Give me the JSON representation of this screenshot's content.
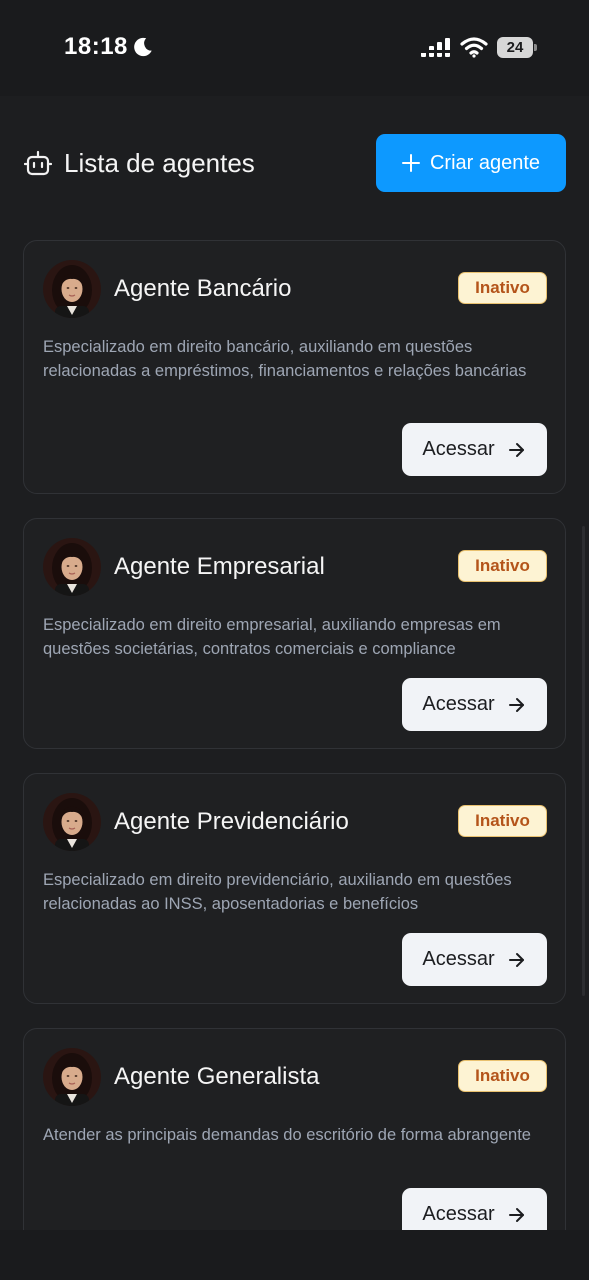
{
  "status_bar": {
    "time": "18:18",
    "battery": "24"
  },
  "header": {
    "title": "Lista de agentes",
    "create_label": "Criar agente"
  },
  "agents": [
    {
      "name": "Agente Bancário",
      "status": "Inativo",
      "description": "Especializado em direito bancário, auxiliando em questões relacionadas a empréstimos, financiamentos e relações bancárias",
      "action_label": "Acessar"
    },
    {
      "name": "Agente Empresarial",
      "status": "Inativo",
      "description": "Especializado em direito empresarial, auxiliando empresas em questões societárias, contratos comerciais e compliance",
      "action_label": "Acessar"
    },
    {
      "name": "Agente Previdenciário",
      "status": "Inativo",
      "description": "Especializado em direito previdenciário, auxiliando em questões relacionadas ao INSS, aposentadorias e benefícios",
      "action_label": "Acessar"
    },
    {
      "name": "Agente Generalista",
      "status": "Inativo",
      "description": "Atender as principais demandas do escritório de forma abrangente",
      "action_label": "Acessar"
    }
  ],
  "colors": {
    "accent": "#0d99ff",
    "badge_bg": "#fdf3d3",
    "badge_text": "#b4541a",
    "background": "#1d1e20"
  },
  "icons": [
    "moon-icon",
    "signal-icon",
    "wifi-icon",
    "battery-icon",
    "robot-icon",
    "plus-icon",
    "arrow-right-icon"
  ]
}
